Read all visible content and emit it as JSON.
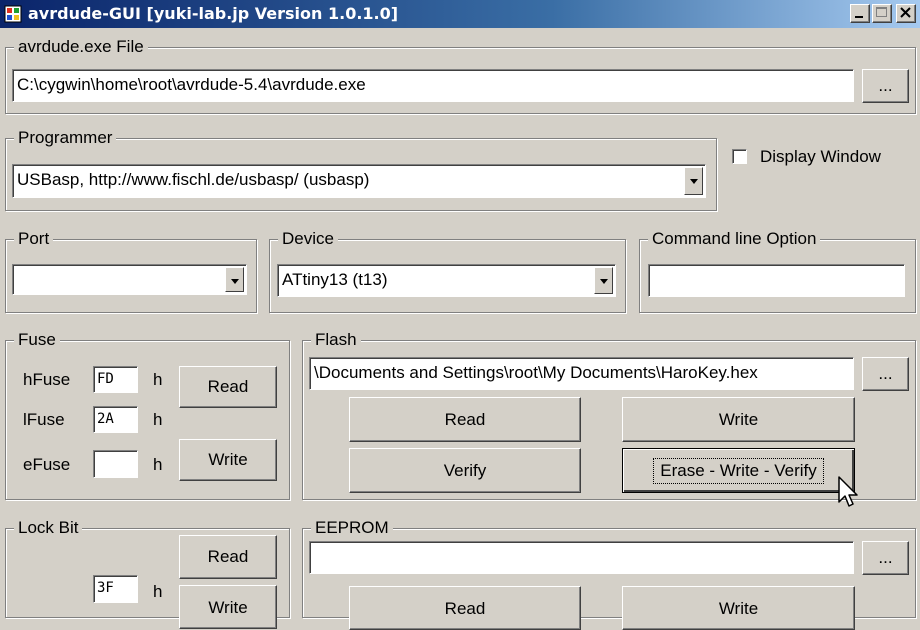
{
  "window": {
    "title": "avrdude-GUI [yuki-lab.jp Version 1.0.1.0]",
    "controls": [
      "minimize-icon",
      "maximize-icon",
      "close-icon"
    ]
  },
  "avrdude_file": {
    "legend": "avrdude.exe File",
    "path": "C:\\cygwin\\home\\root\\avrdude-5.4\\avrdude.exe",
    "browse_label": "..."
  },
  "programmer": {
    "legend": "Programmer",
    "selected": "USBasp, http://www.fischl.de/usbasp/ (usbasp)"
  },
  "display_window": {
    "label": "Display Window",
    "checked": false
  },
  "port": {
    "legend": "Port",
    "selected": ""
  },
  "device": {
    "legend": "Device",
    "selected": "ATtiny13 (t13)"
  },
  "command_line": {
    "legend": "Command line Option",
    "value": ""
  },
  "fuse": {
    "legend": "Fuse",
    "hfuse_label": "hFuse",
    "hfuse_value": "FD",
    "lfuse_label": "lFuse",
    "lfuse_value": "2A",
    "efuse_label": "eFuse",
    "efuse_value": "",
    "suffix": "h",
    "read_label": "Read",
    "write_label": "Write"
  },
  "flash": {
    "legend": "Flash",
    "path": "\\Documents and Settings\\root\\My Documents\\HaroKey.hex",
    "browse_label": "...",
    "read_label": "Read",
    "write_label": "Write",
    "verify_label": "Verify",
    "erase_write_verify_label": "Erase - Write - Verify"
  },
  "lock_bit": {
    "legend": "Lock Bit",
    "read_label": "Read",
    "value": "3F",
    "suffix": "h",
    "write_label": "Write"
  },
  "eeprom": {
    "legend": "EEPROM",
    "path": "",
    "browse_label": "...",
    "read_label": "Read",
    "write_label": "Write"
  },
  "colors": {
    "window_bg": "#d4d0c8",
    "titlebar_start": "#0a246a",
    "titlebar_end": "#a6caf0"
  }
}
